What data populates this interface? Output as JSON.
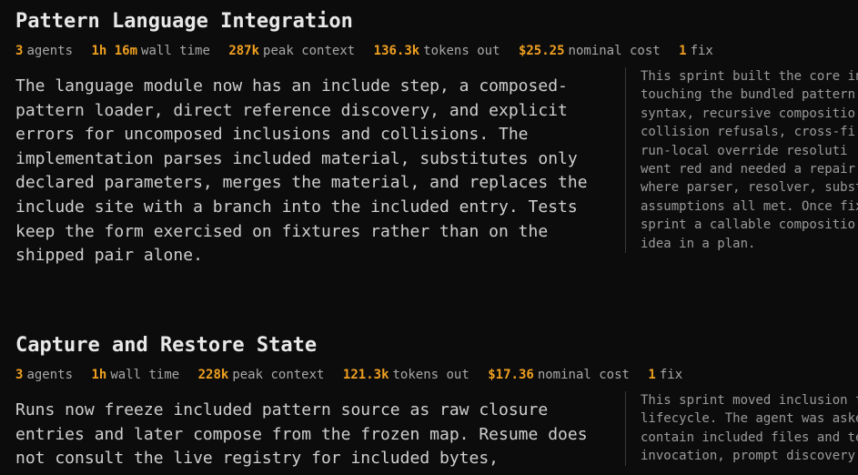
{
  "sections": [
    {
      "title": "Pattern Language Integration",
      "stats": [
        {
          "num": "3",
          "label": "agents"
        },
        {
          "num": "1h 16m",
          "label": "wall time"
        },
        {
          "num": "287k",
          "label": "peak context"
        },
        {
          "num": "136.3k",
          "label": "tokens out"
        },
        {
          "num": "$25.25",
          "label": "nominal cost"
        },
        {
          "num": "1",
          "label": "fix"
        }
      ],
      "summary": "The language module now has an include step, a composed-pattern loader, direct reference discovery, and explicit errors for uncomposed inclusions and collisions. The implementation parses included material, substitutes only declared parameters, merges the material, and replaces the include site with a branch into the included entry. Tests keep the form exercised on fixtures rather than on the shipped pair alone.",
      "sidenote": "This sprint built the core in\ntouching the bundled pattern\nsyntax, recursive compositio\ncollision refusals, cross-fi\nrun-local override resoluti\nwent red and needed a repair\nwhere parser, resolver, subst\nassumptions all met. Once fix\nsprint a callable compositio\nidea in a plan."
    },
    {
      "title": "Capture and Restore State",
      "stats": [
        {
          "num": "3",
          "label": "agents"
        },
        {
          "num": "1h",
          "label": "wall time"
        },
        {
          "num": "228k",
          "label": "peak context"
        },
        {
          "num": "121.3k",
          "label": "tokens out"
        },
        {
          "num": "$17.36",
          "label": "nominal cost"
        },
        {
          "num": "1",
          "label": "fix"
        }
      ],
      "summary": "Runs now freeze included pattern source as raw closure entries and later compose from the frozen map. Resume does not consult the live registry for included bytes,",
      "sidenote": "This sprint moved inclusion t\nlifecycle. The agent was aske\ncontain included files and te\ninvocation, prompt discovery"
    }
  ]
}
